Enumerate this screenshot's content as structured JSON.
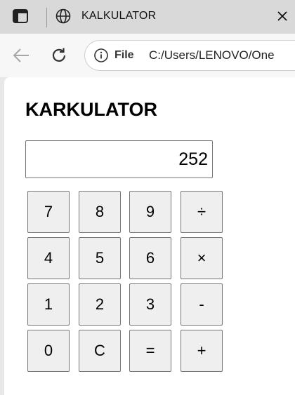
{
  "browser": {
    "tab_title": "KALKULATOR",
    "address_scheme_label": "File",
    "address_url": "C:/Users/LENOVO/One",
    "icons": {
      "tab_actions": "tab-actions-icon",
      "tab_favicon": "globe-icon",
      "tab_close": "close-icon",
      "back": "back-arrow-icon",
      "reload": "reload-icon",
      "site_info": "info-icon"
    }
  },
  "page": {
    "heading": "KARKULATOR",
    "display_value": "252",
    "keys": {
      "k7": "7",
      "k8": "8",
      "k9": "9",
      "divide": "÷",
      "k4": "4",
      "k5": "5",
      "k6": "6",
      "multiply": "×",
      "k1": "1",
      "k2": "2",
      "k3": "3",
      "minus": "-",
      "k0": "0",
      "clear": "C",
      "equals": "=",
      "plus": "+"
    }
  },
  "colors": {
    "tabbar_bg": "#d9d9d9",
    "toolbar_bg": "#f7f7f7",
    "key_bg": "#efefef",
    "key_border": "#767676",
    "page_bg": "#ffffff"
  }
}
